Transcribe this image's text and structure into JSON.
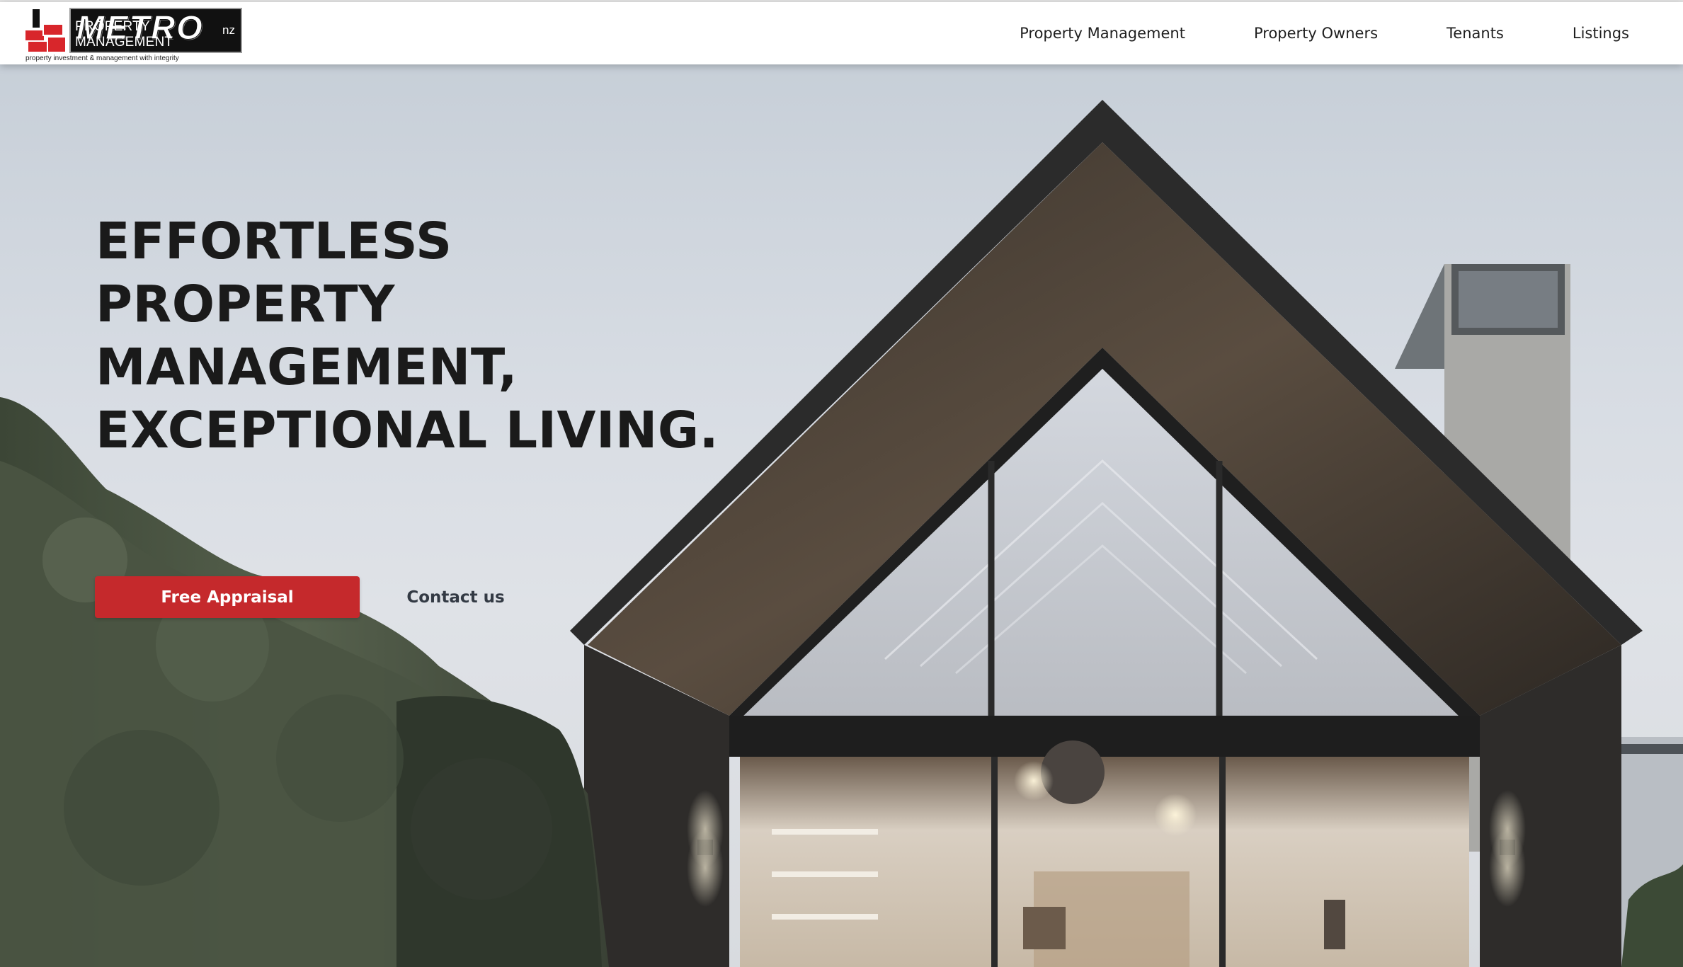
{
  "header": {
    "logo": {
      "name": "METRO",
      "suffix": "nz",
      "subtitle": "PROPERTY MANAGEMENT",
      "tagline": "property investment & management with integrity"
    },
    "nav": [
      {
        "label": "Property Management"
      },
      {
        "label": "Property Owners"
      },
      {
        "label": "Tenants"
      },
      {
        "label": "Listings"
      }
    ]
  },
  "hero": {
    "headline": {
      "line1": "EFFORTLESS PROPERTY",
      "line2": "MANAGEMENT,",
      "line3": "EXCEPTIONAL LIVING."
    },
    "primary_button": "Free Appraisal",
    "secondary_button": "Contact us",
    "background_image": "modern-gable-house-photo"
  },
  "colors": {
    "brand_red": "#c5292c",
    "logo_red": "#d8262b",
    "headline_text": "#1a1a1a",
    "sky": "#d7dce3"
  }
}
